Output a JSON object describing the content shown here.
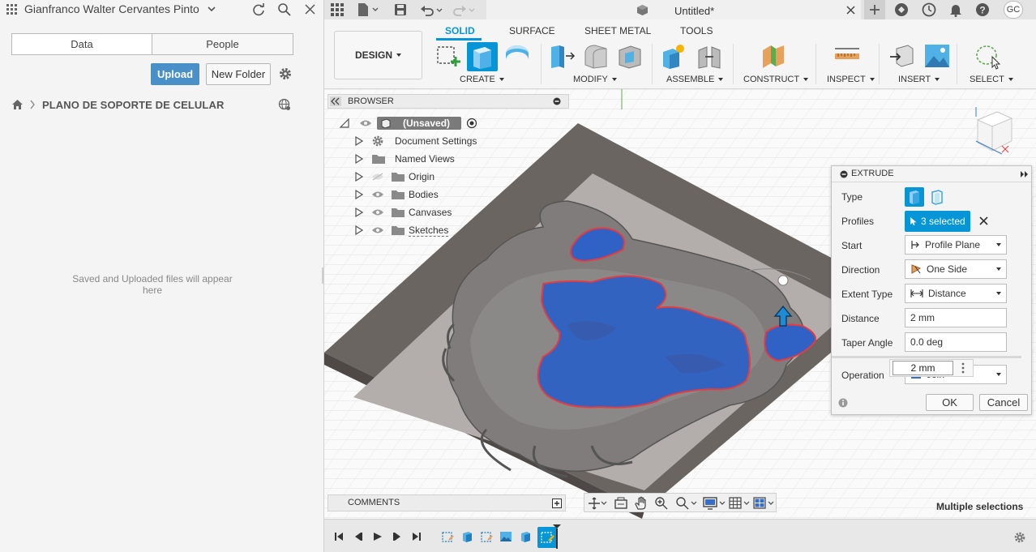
{
  "left_panel": {
    "user_name": "Gianfranco Walter Cervantes Pinto",
    "tabs": [
      "Data",
      "People"
    ],
    "upload_label": "Upload",
    "new_folder_label": "New Folder",
    "project_title": "PLANO DE SOPORTE DE CELULAR",
    "empty_message": "Saved and Uploaded files will appear here"
  },
  "topbar": {
    "document_title": "Untitled*",
    "user_initials": "GC"
  },
  "toolbar": {
    "workspace_label": "DESIGN",
    "tabs": [
      "SOLID",
      "SURFACE",
      "SHEET METAL",
      "TOOLS"
    ],
    "active_tab": "SOLID",
    "groups": [
      "CREATE",
      "MODIFY",
      "ASSEMBLE",
      "CONSTRUCT",
      "INSPECT",
      "INSERT",
      "SELECT"
    ]
  },
  "browser": {
    "title": "BROWSER",
    "root": "(Unsaved)",
    "items": [
      "Document Settings",
      "Named Views",
      "Origin",
      "Bodies",
      "Canvases",
      "Sketches"
    ]
  },
  "extrude": {
    "title": "EXTRUDE",
    "labels": {
      "type": "Type",
      "profiles": "Profiles",
      "start": "Start",
      "direction": "Direction",
      "extent_type": "Extent Type",
      "distance": "Distance",
      "taper_angle": "Taper Angle",
      "operation": "Operation"
    },
    "values": {
      "profiles": "3 selected",
      "start": "Profile Plane",
      "direction": "One Side",
      "extent_type": "Distance",
      "distance": "2 mm",
      "taper_angle": "0.0 deg",
      "operation": "Join"
    },
    "inline_input": "2 mm",
    "ok_label": "OK",
    "cancel_label": "Cancel"
  },
  "comments_label": "COMMENTS",
  "status_text": "Multiple selections",
  "colors": {
    "accent": "#0696d7",
    "upload_button": "#4a90c8",
    "selection_blue": "#2f62c4"
  }
}
